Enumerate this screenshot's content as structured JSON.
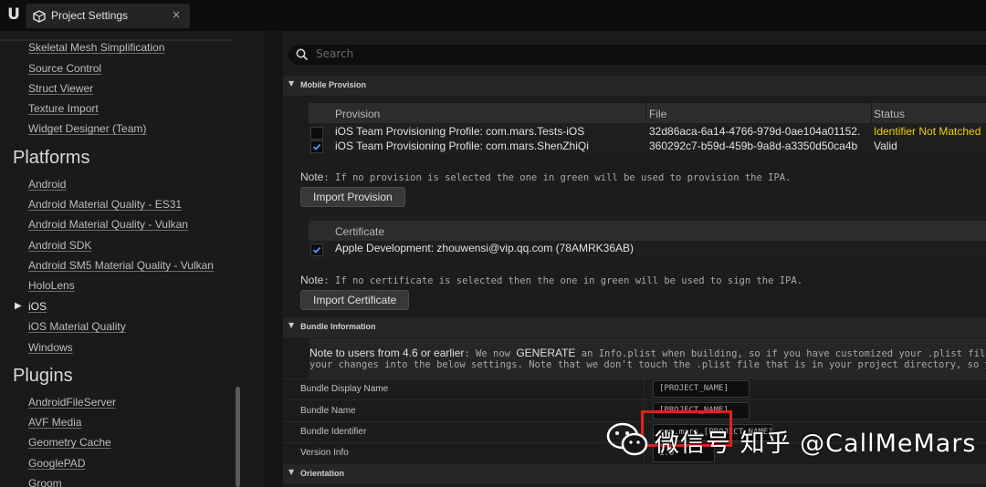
{
  "window": {
    "tab_title": "Project Settings",
    "close_glyph": "×"
  },
  "sidebar": {
    "top_items": [
      "Skeletal Mesh Simplification",
      "Source Control",
      "Struct Viewer",
      "Texture Import",
      "Widget Designer (Team)"
    ],
    "platforms_heading": "Platforms",
    "platforms": [
      "Android",
      "Android Material Quality - ES31",
      "Android Material Quality - Vulkan",
      "Android SDK",
      "Android SM5 Material Quality - Vulkan",
      "HoloLens",
      "iOS",
      "iOS Material Quality",
      "Windows"
    ],
    "selected_platform": "iOS",
    "plugins_heading": "Plugins",
    "plugins": [
      "AndroidFileServer",
      "AVF Media",
      "Geometry Cache",
      "GooglePAD",
      "Groom"
    ]
  },
  "search": {
    "placeholder": "Search"
  },
  "mobile_provision": {
    "section_title": "Mobile Provision",
    "columns": [
      "Provision",
      "File",
      "Status"
    ],
    "rows": [
      {
        "checked": false,
        "provision": "iOS Team Provisioning Profile: com.mars.Tests-iOS",
        "file": "32d86aca-6a14-4766-979d-0ae104a01152.",
        "status": "Identifier Not Matched",
        "status_color": "#f0d000"
      },
      {
        "checked": true,
        "provision": "iOS Team Provisioning Profile: com.mars.ShenZhiQi",
        "file": "360292c7-b59d-459b-9a8d-a3350d50ca4b",
        "status": "Valid",
        "status_color": "#e2e2e2"
      }
    ],
    "note_label": "Note",
    "note_text": ": If no provision is selected the one in green will be used to provision the IPA.",
    "import_button": "Import Provision"
  },
  "certificate": {
    "column": "Certificate",
    "rows": [
      {
        "checked": true,
        "name": "Apple Development: zhouwensi@vip.qq.com (78AMRK36AB)"
      }
    ],
    "note_label": "Note",
    "note_text": ": If no certificate is selected then the one in green will be used to sign the IPA.",
    "import_button": "Import Certificate"
  },
  "bundle_info": {
    "section_title": "Bundle Information",
    "note_strong": "Note to users from 4.6 or earlier",
    "note_line1": ": We now ",
    "note_generate": "GENERATE",
    "note_line1_rest": " an Info.plist when building, so if you have customized your .plist file, y",
    "note_line2": "your changes into the below settings. Note that we don't touch the .plist file that is in your project directory, so you",
    "fields": [
      {
        "label": "Bundle Display Name",
        "value": "[PROJECT_NAME]"
      },
      {
        "label": "Bundle Name",
        "value": "[PROJECT_NAME]"
      },
      {
        "label": "Bundle Identifier",
        "value": "com.mars.[PROJECT_NAME]"
      },
      {
        "label": "Version Info",
        "value": "1.0"
      }
    ]
  },
  "orientation": {
    "section_title": "Orientation"
  },
  "watermark": {
    "text": "微信号  知乎 @CallMeMars"
  },
  "colors": {
    "accent_check": "#4aa0ff",
    "warning": "#f0d000",
    "highlight_box": "#e02020"
  }
}
